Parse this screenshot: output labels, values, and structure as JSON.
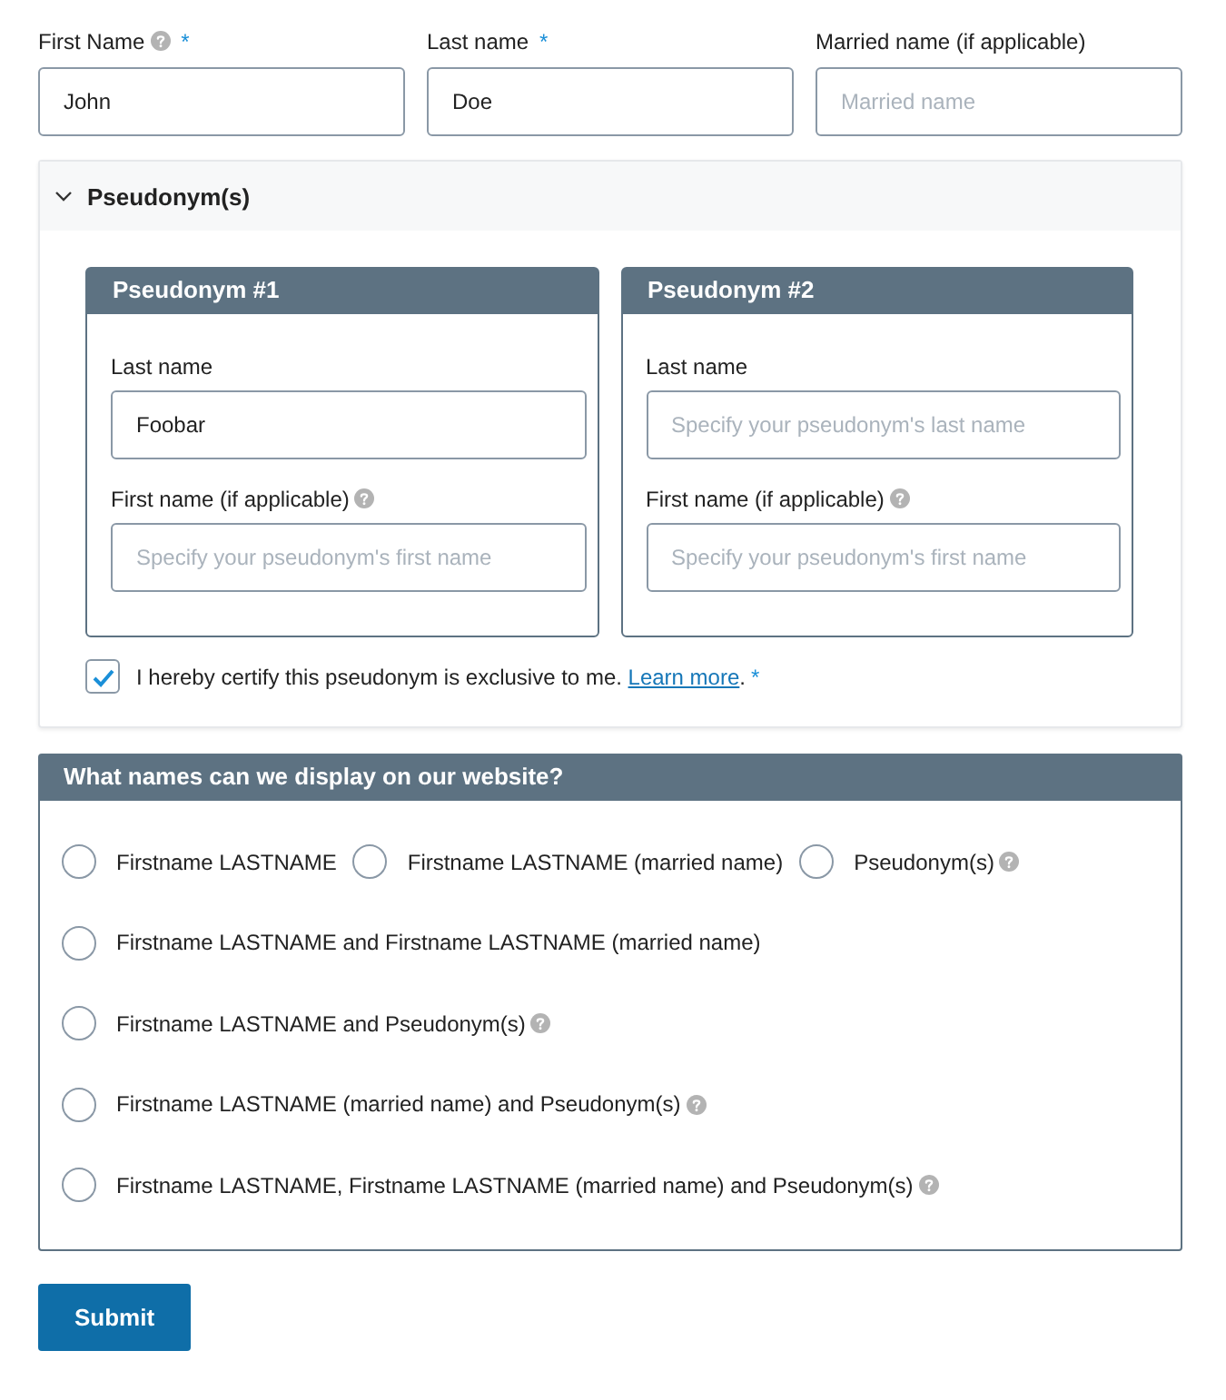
{
  "name_fields": [
    {
      "label": "First Name",
      "help": true,
      "required_mark": "*",
      "value": "John"
    },
    {
      "label": "Last name",
      "required_mark": "*",
      "value": "Doe"
    },
    {
      "label": "Married name (if applicable)",
      "placeholder": "Married name"
    }
  ],
  "pseudonyms": {
    "title": "Pseudonym(s)",
    "expanded": true,
    "cards": [
      {
        "title": "Pseudonym #1",
        "fields": [
          {
            "label": "Last name",
            "value": "Foobar"
          },
          {
            "label": "First name (if applicable)",
            "help": true,
            "placeholder": "Specify your pseudonym's first name"
          }
        ]
      },
      {
        "title": "Pseudonym #2",
        "fields": [
          {
            "label": "Last name",
            "placeholder": "Specify your pseudonym's last name"
          },
          {
            "label": "First name (if applicable)",
            "help": true,
            "placeholder": "Specify your pseudonym's first name"
          }
        ]
      }
    ],
    "certify": {
      "checked": true,
      "text": "I hereby certify this pseudonym is exclusive to me. ",
      "link": "Learn more",
      "after": ".",
      "required_mark": "*"
    }
  },
  "display": {
    "title": "What names can we display on our website?",
    "rows": [
      [
        {
          "label": "Firstname LASTNAME",
          "selected": false
        },
        {
          "label": "Firstname LASTNAME (married name)",
          "selected": false
        },
        {
          "label": "Pseudonym(s)",
          "help": true,
          "selected": false
        }
      ],
      [
        {
          "label": "Firstname LASTNAME and Firstname LASTNAME (married name)",
          "selected": false
        }
      ],
      [
        {
          "label": "Firstname LASTNAME and Pseudonym(s)",
          "help": true,
          "selected": false
        }
      ],
      [
        {
          "label": "Firstname LASTNAME (married name) and Pseudonym(s)",
          "help": true,
          "selected": false
        }
      ],
      [
        {
          "label": "Firstname LASTNAME, Firstname LASTNAME (married name) and Pseudonym(s)",
          "help": true,
          "selected": false
        }
      ]
    ]
  },
  "submit": "Submit"
}
